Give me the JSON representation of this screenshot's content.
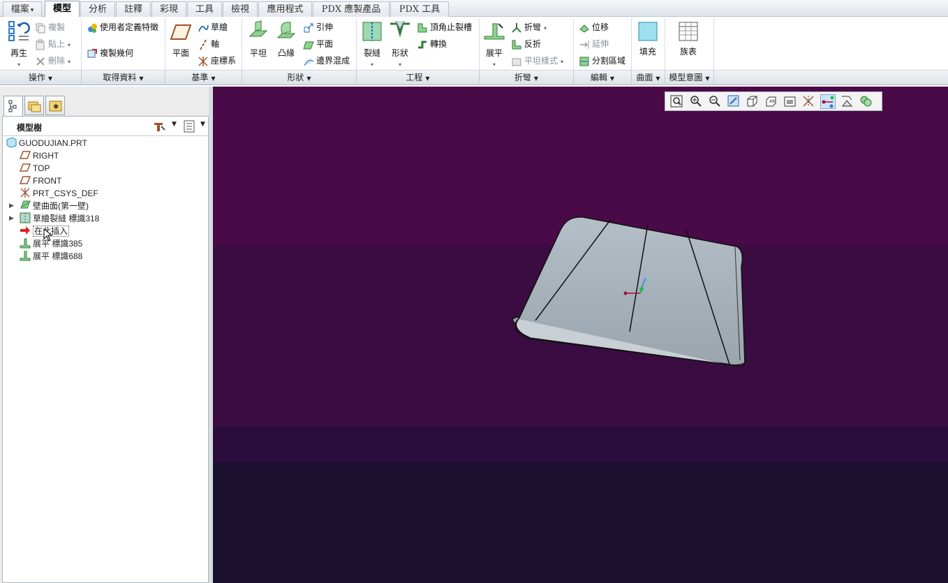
{
  "tabs": [
    {
      "label": "檔案",
      "dropdown": true
    },
    {
      "label": "模型",
      "active": true
    },
    {
      "label": "分析"
    },
    {
      "label": "註釋"
    },
    {
      "label": "彩現"
    },
    {
      "label": "工具"
    },
    {
      "label": "檢視"
    },
    {
      "label": "應用程式"
    },
    {
      "label": "PDX 應製產品"
    },
    {
      "label": "PDX 工具"
    }
  ],
  "ribbon": {
    "operations": {
      "regenerate": "再生",
      "copy": "複製",
      "paste": "貼上",
      "delete": "刪除"
    },
    "get_data": {
      "user_defined_feature": "使用者定義特徵",
      "copy_geometry": "複製幾何"
    },
    "datum": {
      "plane": "平面",
      "sketch": "草繪",
      "axis": "軸",
      "csys": "座標系"
    },
    "shapes": {
      "flat": "平坦",
      "flange": "凸緣",
      "extrude": "引伸",
      "planar": "平面",
      "boundary_blend": "邊界混成"
    },
    "engineering": {
      "rip": "裂縫",
      "form": "形狀",
      "corner_relief": "頂角止裂槽",
      "convert": "轉換"
    },
    "bends": {
      "unbend": "展平",
      "bend": "折彎",
      "bend_back": "反折",
      "flat_pattern": "平坦樣式"
    },
    "editing": {
      "translate": "位移",
      "extend": "延伸",
      "split_area": "分割區域"
    },
    "surfaces": {
      "fill": "填充"
    },
    "model_intent": {
      "family_table": "族表"
    }
  },
  "groups": [
    {
      "label": "操作"
    },
    {
      "label": "取得資料"
    },
    {
      "label": "基準"
    },
    {
      "label": "形狀"
    },
    {
      "label": "工程"
    },
    {
      "label": "折彎"
    },
    {
      "label": "編輯"
    },
    {
      "label": "曲面"
    },
    {
      "label": "模型意圖"
    }
  ],
  "model_tree": {
    "title": "模型樹",
    "items": [
      {
        "label": "GUODUJIAN.PRT",
        "icon": "part-icon"
      },
      {
        "label": "RIGHT",
        "icon": "datum-plane-icon"
      },
      {
        "label": "TOP",
        "icon": "datum-plane-icon"
      },
      {
        "label": "FRONT",
        "icon": "datum-plane-icon"
      },
      {
        "label": "PRT_CSYS_DEF",
        "icon": "csys-icon"
      },
      {
        "label": "壁曲面(第一壁)",
        "icon": "wall-icon",
        "expandable": true
      },
      {
        "label": "草繪裂縫 標識318",
        "icon": "sketched-rip-icon",
        "expandable": true
      },
      {
        "label": "在此插入",
        "icon": "insert-arrow-icon"
      },
      {
        "label": "展平 標識385",
        "icon": "unbend-icon"
      },
      {
        "label": "展平 標識688",
        "icon": "unbend-icon"
      }
    ]
  },
  "view_toolbar": {
    "buttons": [
      "refit-icon",
      "zoom-in-icon",
      "zoom-out-icon",
      "repaint-icon",
      "display-style-icon",
      "saved-views-icon",
      "view-manager-icon",
      "datum-display-icon",
      "spin-center-icon",
      "annotation-display-icon",
      "appearance-icon"
    ]
  },
  "colors": {
    "viewport_top": "#4a0a48",
    "viewport_bottom": "#1b1030",
    "part": "#a7b1ba"
  }
}
